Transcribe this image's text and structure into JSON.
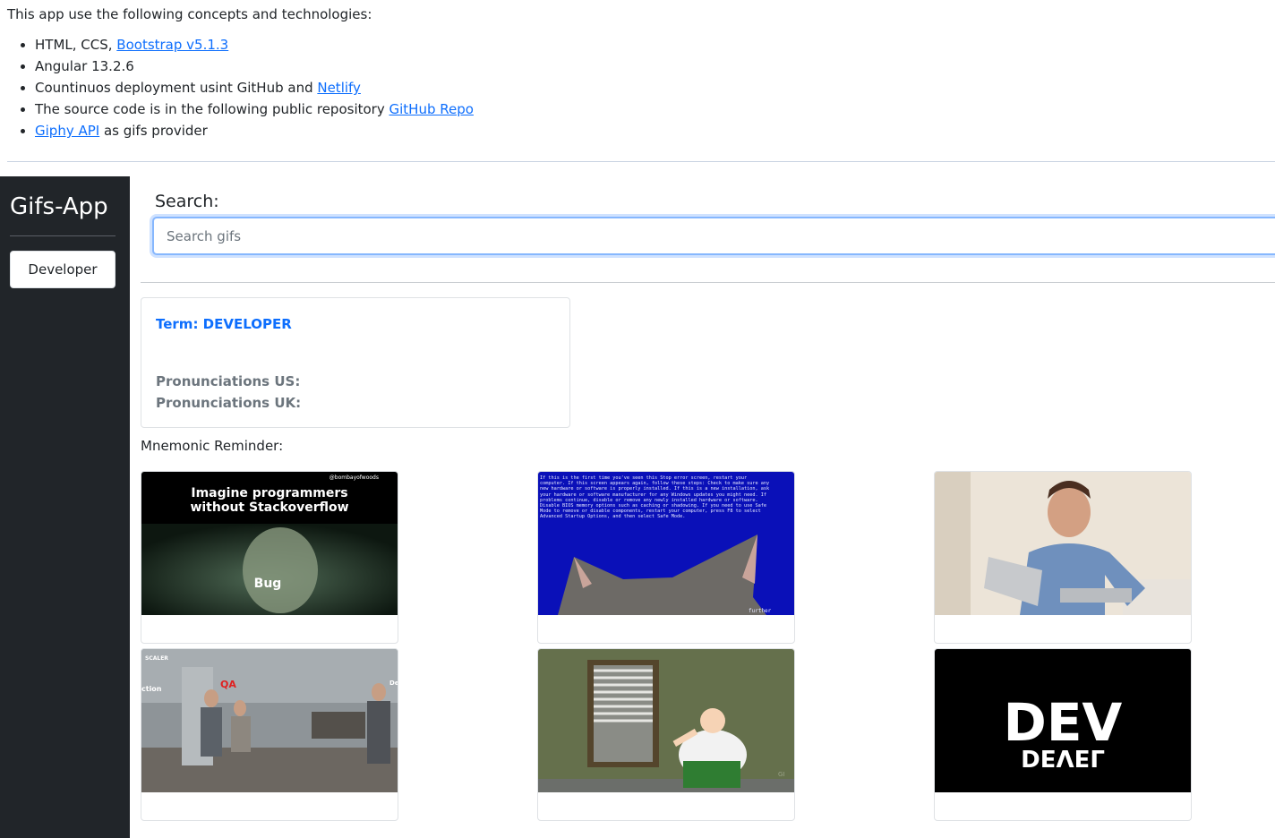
{
  "intro": {
    "text": "This app use the following concepts and technologies:",
    "items": [
      {
        "text": "HTML, CCS, ",
        "link": "Bootstrap v5.1.3",
        "after": ""
      },
      {
        "text": "Angular 13.2.6",
        "link": "",
        "after": ""
      },
      {
        "text": "Countinuos deployment usint GitHub and ",
        "link": "Netlify",
        "after": ""
      },
      {
        "text": "The source code is in the following public repository ",
        "link": "GitHub Repo",
        "after": ""
      },
      {
        "text": "",
        "link": "Giphy API",
        "after": " as gifs provider"
      }
    ]
  },
  "sidebar": {
    "brand": "Gifs-App",
    "history": [
      "Developer"
    ]
  },
  "search": {
    "label": "Search:",
    "placeholder": "Search gifs",
    "value": ""
  },
  "term_card": {
    "title": "Term: DEVELOPER",
    "pron_us": "Pronunciations US:",
    "pron_uk": "Pronunciations UK:"
  },
  "mnemonic_label": "Mnemonic Reminder:",
  "gifs": [
    {
      "caption_line1": "Imagine programmers",
      "caption_line2": "without Stackoverflow",
      "watermark": "@bombayofwoods",
      "subtitle": "Bug"
    },
    {
      "screen_text": "If this is the first time you've seen this Stop error screen, restart your computer. If this screen appears again, follow these steps: Check to make sure any new hardware or software is properly installed. If this is a new installation, ask your hardware or software manufacturer for any Windows updates you might need. If problems continue, disable or remove any newly installed hardware or software. Disable BIOS memory options such as caching or shadowing. If you need to use Safe Mode to remove or disable components, restart your computer, press F8 to select Advanced Startup Options, and then select Safe Mode.",
      "tail": "further"
    },
    {
      "description": ""
    },
    {
      "watermark": "SCALER",
      "label_qa": "QA",
      "label_left": "ction",
      "label_right": "De"
    },
    {
      "watermark": "GI"
    },
    {
      "word1": "DEV",
      "word2": "DEVEL"
    }
  ]
}
